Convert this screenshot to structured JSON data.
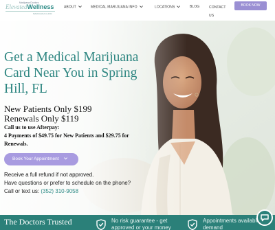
{
  "logo": {
    "top_text": "Marijuana Doctors",
    "name_part1": "Elevated",
    "name_part2": "Wellness",
    "sub_text": "MARIJUANA CLINIC"
  },
  "nav": {
    "items": [
      "ABOUT",
      "MEDICAL MARIJUANA INFO",
      "LOCATIONS",
      "BLOG",
      "CONTACT",
      "US"
    ],
    "cta": "BOOK NOW"
  },
  "hero": {
    "title_lines": [
      "Get a Medical Marijuana",
      "Card Near You in Spring",
      "Hill, FL"
    ],
    "price_new": "New Patients Only $199",
    "price_renewal": "Renewals Only $119",
    "afterpay_lines": [
      "Call us to use Afterpay:",
      "4 Payments of $49.75 for New Patients and $29.75 for",
      "Renewals."
    ],
    "button": "Book Your Appointment",
    "refund": "Receive a full refund if not approved.",
    "question": "Have questions or prefer to schedule on the phone?",
    "call_prefix": "Call or text us: ",
    "phone": "(352) 310-9058"
  },
  "band": {
    "title": "The Doctors Trusted",
    "item1": "No risk guarantee - get",
    "item1_line2": "approved or your money",
    "item2": "Appointments available on",
    "item2_line2": "demand"
  },
  "colors": {
    "teal": "#2d8b86",
    "purple": "#9a8fd3",
    "band": "#2b8079"
  },
  "icons": [
    "chevron-down-icon",
    "shield-check-icon",
    "chat-icon"
  ]
}
